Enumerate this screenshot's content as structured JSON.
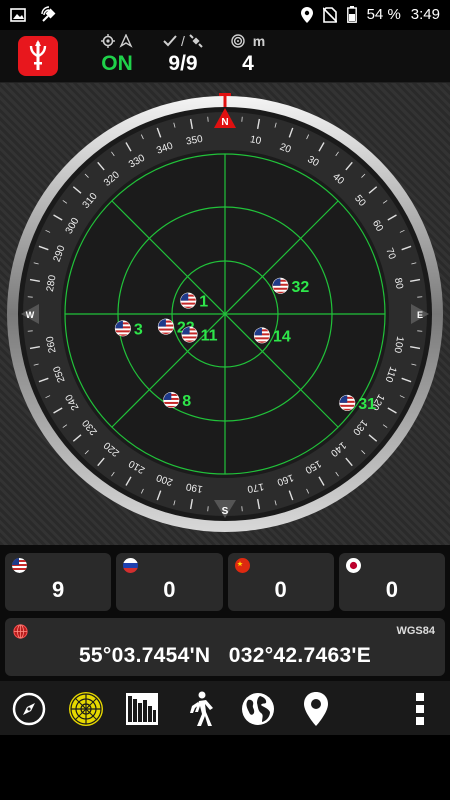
{
  "status_bar": {
    "battery": "54 %",
    "time": "3:49"
  },
  "header": {
    "gps_state": "ON",
    "sats_used_total": "9/9",
    "accuracy_value": "4",
    "accuracy_unit": "m"
  },
  "compass": {
    "north_label": "N",
    "south_label": "S",
    "east_label": "E",
    "west_label": "W",
    "degree_labels": [
      "10",
      "20",
      "30",
      "40",
      "50",
      "60",
      "70",
      "80",
      "100",
      "110",
      "120",
      "130",
      "140",
      "150",
      "160",
      "170",
      "190",
      "200",
      "210",
      "220",
      "230",
      "240",
      "250",
      "260",
      "280",
      "290",
      "300",
      "310",
      "320",
      "330",
      "340",
      "350"
    ]
  },
  "satellites": [
    {
      "id": "1",
      "constellation": "GPS",
      "azimuth": 290,
      "elevation": 68
    },
    {
      "id": "32",
      "constellation": "GPS",
      "azimuth": 63,
      "elevation": 55
    },
    {
      "id": "3",
      "constellation": "GPS",
      "azimuth": 262,
      "elevation": 32
    },
    {
      "id": "22",
      "constellation": "GPS",
      "azimuth": 258,
      "elevation": 56
    },
    {
      "id": "11",
      "constellation": "GPS",
      "azimuth": 240,
      "elevation": 67
    },
    {
      "id": "14",
      "constellation": "GPS",
      "azimuth": 120,
      "elevation": 66
    },
    {
      "id": "8",
      "constellation": "GPS",
      "azimuth": 212,
      "elevation": 33
    },
    {
      "id": "31",
      "constellation": "GPS",
      "azimuth": 126,
      "elevation": 5
    }
  ],
  "constellations": [
    {
      "name": "GPS",
      "count": "9"
    },
    {
      "name": "GLONASS",
      "count": "0"
    },
    {
      "name": "BeiDou",
      "count": "0"
    },
    {
      "name": "QZSS",
      "count": "0"
    }
  ],
  "position": {
    "datum": "WGS84",
    "coordinates": "55°03.7454'N   032°42.7463'E"
  },
  "toolbar": {
    "icons": [
      "compass-icon",
      "radar-icon",
      "signal-bars-icon",
      "walking-icon",
      "globe-icon",
      "map-pin-icon",
      "overflow-menu-icon"
    ]
  },
  "colors": {
    "grid_green": "#21c23a",
    "label_green": "#2ee64a",
    "gps_on": "#1fd14a",
    "north_red": "#e01010",
    "brand_red": "#e8171d"
  }
}
